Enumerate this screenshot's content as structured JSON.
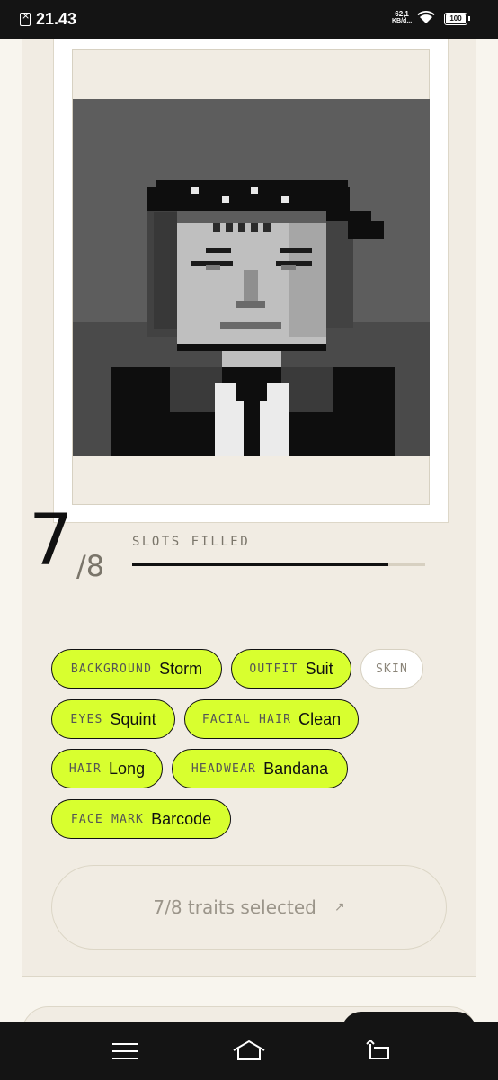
{
  "status_bar": {
    "time": "21.43",
    "net_speed_value": "62,1",
    "net_speed_unit": "KB/d...",
    "battery": "100"
  },
  "slots": {
    "filled": "7",
    "total": "/8",
    "label": "SLOTS FILLED",
    "progress_fraction": 0.875
  },
  "traits": [
    {
      "key": "BACKGROUND",
      "value": "Storm",
      "selected": true
    },
    {
      "key": "OUTFIT",
      "value": "Suit",
      "selected": true
    },
    {
      "key": "SKIN",
      "value": "",
      "selected": false
    },
    {
      "key": "EYES",
      "value": "Squint",
      "selected": true
    },
    {
      "key": "FACIAL HAIR",
      "value": "Clean",
      "selected": true
    },
    {
      "key": "HAIR",
      "value": "Long",
      "selected": true
    },
    {
      "key": "HEADWEAR",
      "value": "Bandana",
      "selected": true
    },
    {
      "key": "FACE MARK",
      "value": "Barcode",
      "selected": true
    }
  ],
  "cta": {
    "label": "7/8 traits selected",
    "arrow": "↗"
  },
  "colors": {
    "accent": "#d8ff2f",
    "card": "#f1ece3",
    "ink": "#111111"
  }
}
